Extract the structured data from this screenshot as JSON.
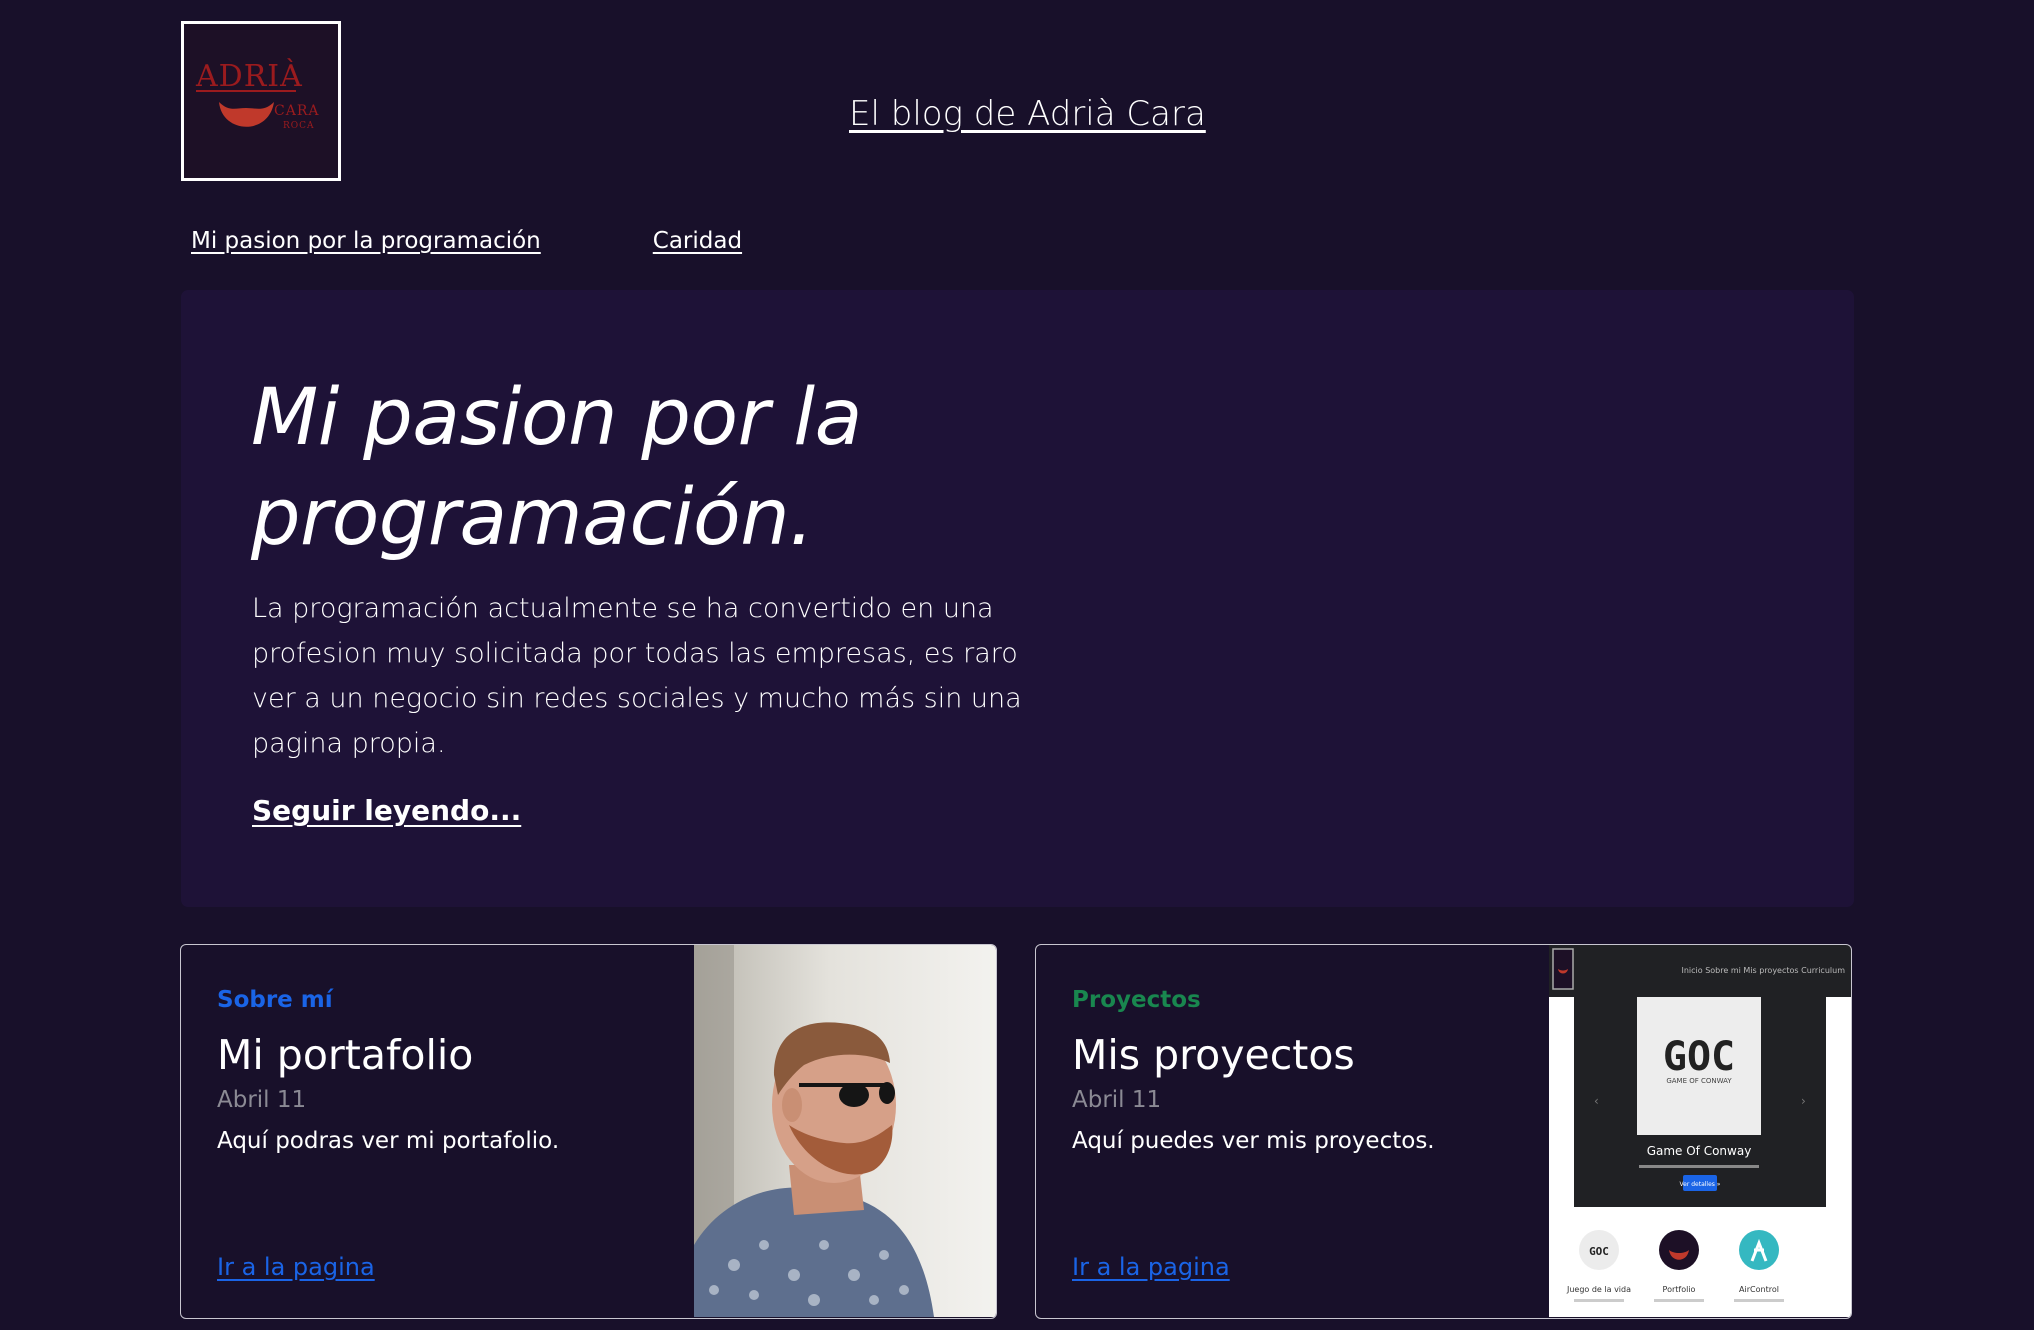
{
  "header": {
    "logo": {
      "line1": "ADRIÀ",
      "line2": "CARA",
      "line3": "ROCA",
      "color": "#9b1b1e"
    },
    "site_title": "El blog de Adrià Cara"
  },
  "nav": {
    "items": [
      {
        "label": "Mi pasion por la programación"
      },
      {
        "label": "Caridad"
      }
    ]
  },
  "hero": {
    "title": "Mi pasion por la programación.",
    "body": "La programación actualmente se ha convertido en una profesion muy solicitada por todas las empresas, es raro ver a un negocio sin redes sociales y mucho más sin una pagina propia.",
    "link": "Seguir leyendo..."
  },
  "cards": [
    {
      "category": "Sobre mí",
      "category_color": "#1a64e6",
      "title": "Mi portafolio",
      "date": "Abril 11",
      "text": "Aquí podras ver mi portafolio.",
      "link": "Ir a la pagina",
      "image": "portrait-photo"
    },
    {
      "category": "Proyectos",
      "category_color": "#19874f",
      "title": "Mis proyectos",
      "date": "Abril 11",
      "text": "Aquí puedes ver mis proyectos.",
      "link": "Ir a la pagina",
      "image": {
        "kind": "website-screenshot",
        "nav": "Inicio  Sobre mi  Mis proyectos  Curriculum",
        "logo": "GOC",
        "logo_sub": "GAME OF CONWAY",
        "slide_title": "Game Of Conway",
        "button": "Ver detalles »",
        "thumbs": [
          "Juego de la vida",
          "Portfolio",
          "AirControl"
        ]
      }
    }
  ]
}
